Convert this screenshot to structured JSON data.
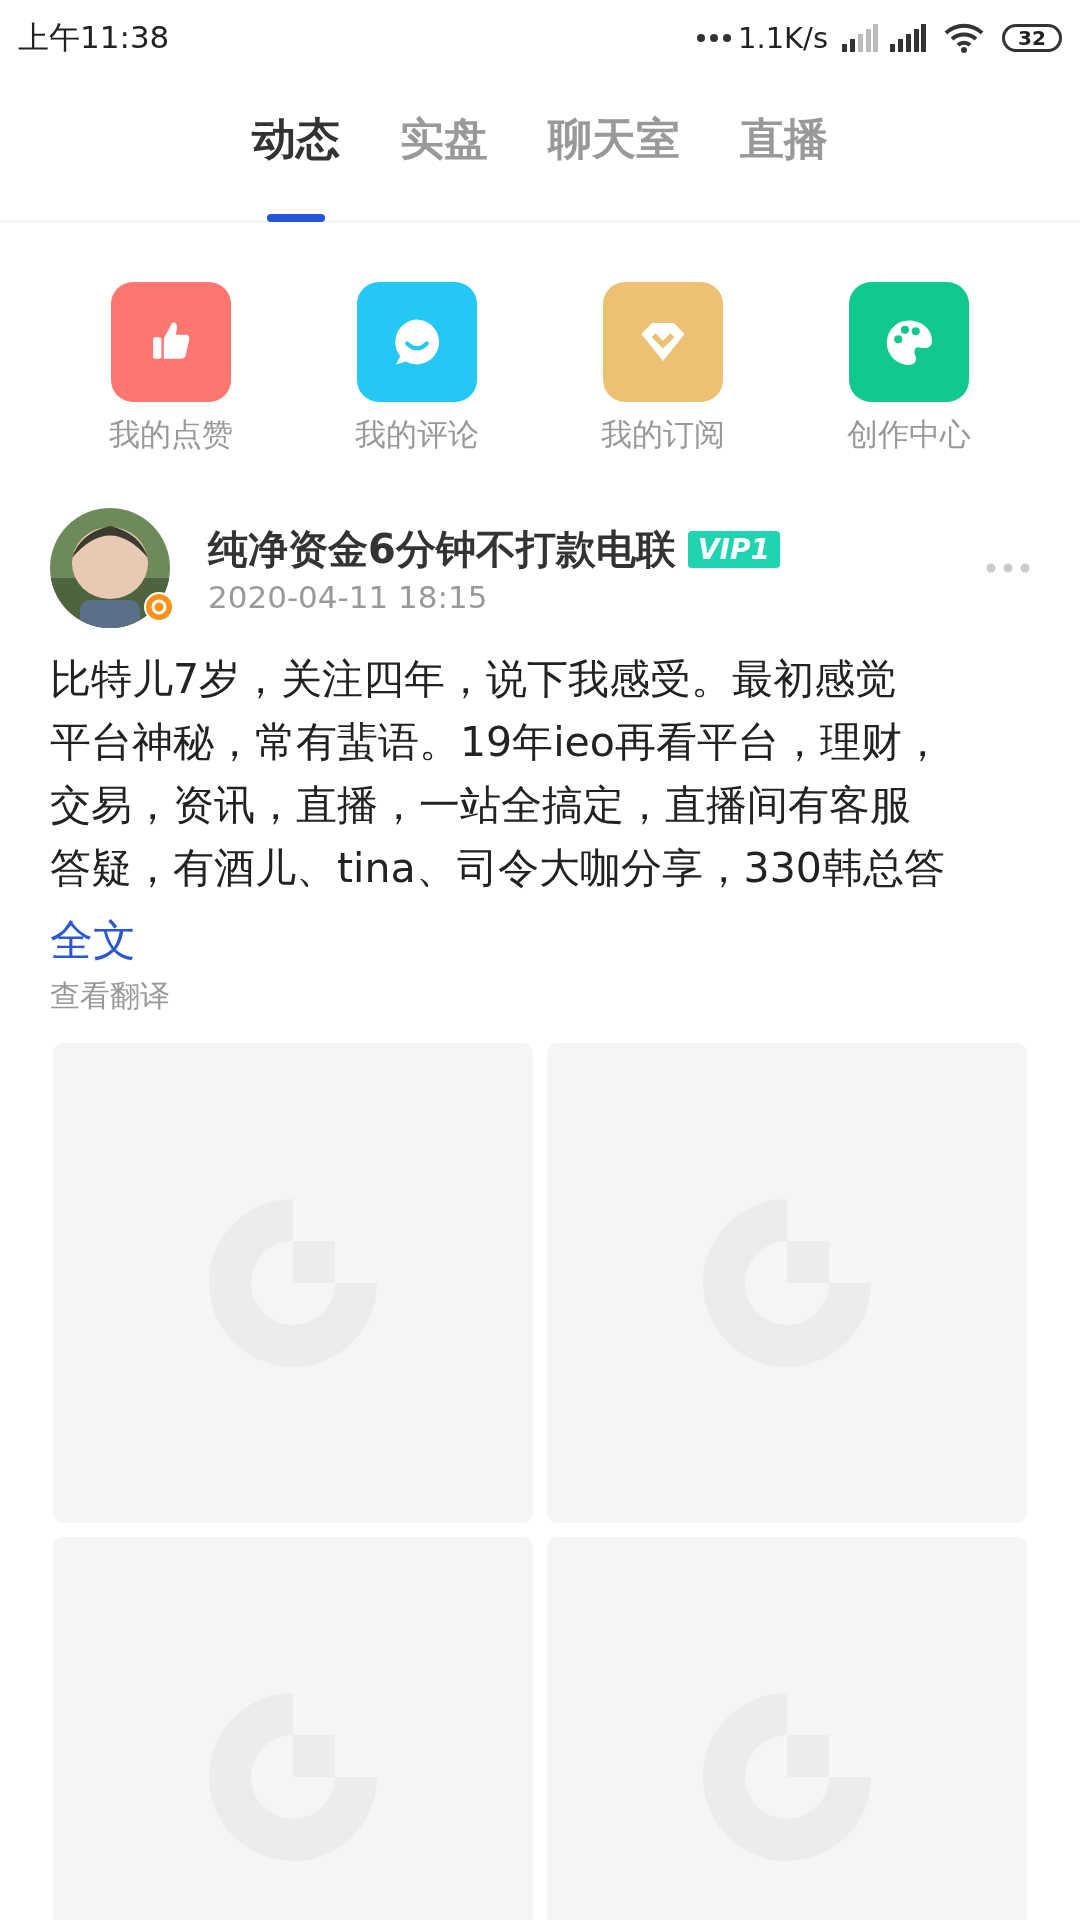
{
  "status_bar": {
    "time": "上午11:38",
    "net_speed": "1.1K/s",
    "battery": "32"
  },
  "tabs": [
    {
      "label": "动态",
      "selected": true
    },
    {
      "label": "实盘",
      "selected": false
    },
    {
      "label": "聊天室",
      "selected": false
    },
    {
      "label": "直播",
      "selected": false
    }
  ],
  "shortcuts": [
    {
      "label": "我的点赞",
      "kind": "like",
      "color": "#fd7670"
    },
    {
      "label": "我的评论",
      "kind": "comment",
      "color": "#23c8f4"
    },
    {
      "label": "我的订阅",
      "kind": "subscribe",
      "color": "#ecc174"
    },
    {
      "label": "创作中心",
      "kind": "create",
      "color": "#11c98e"
    }
  ],
  "post": {
    "author": "纯净资金6分钟不打款电联",
    "badge": "VIP1",
    "time": "2020-04-11 18:15",
    "body_lines": [
      "比特儿7岁，关注四年，说下我感受。最初感觉",
      "平台神秘，常有蜚语。19年ieo再看平台，理财，",
      "交易，资讯，直播，一站全搞定，直播间有客服",
      "答疑，有酒儿、tina、司令大咖分享，330韩总答"
    ],
    "more_link": "全文",
    "translate": "查看翻译",
    "images": [
      {
        "kind": "placeholder"
      },
      {
        "kind": "placeholder"
      },
      {
        "kind": "placeholder"
      },
      {
        "kind": "placeholder"
      }
    ]
  }
}
